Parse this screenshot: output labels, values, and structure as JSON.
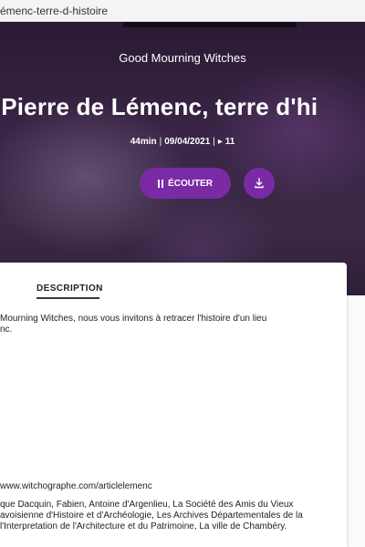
{
  "browser": {
    "url": "émenc-terre-d-histoire"
  },
  "hero": {
    "podcast_name": "Good Mourning Witches",
    "episode_title": "int-Pierre de Lémenc, terre d'hi",
    "duration": "44min",
    "date": "09/04/2021",
    "plays": "▸ 11",
    "listen_label": "ÉCOUTER",
    "colors": {
      "accent": "#7b2aa6"
    }
  },
  "content": {
    "tab_label": "DESCRIPTION",
    "intro_line1": "Mourning Witches, nous vous invitons à retracer l'histoire d'un lieu",
    "intro_line2": "nc.",
    "link_line": "www.witchographe.com/articlelemenc",
    "credits_line1": "que Dacquin, Fabien, Antoine d'Argenlieu,  La Société des Amis du Vieux",
    "credits_line2": "avoisienne d'Histoire et d'Archéologie, Les Archives Départementales de la",
    "credits_line3": "l'Interpretation de l'Architecture et du Patrimoine, La ville de Chambéry."
  }
}
